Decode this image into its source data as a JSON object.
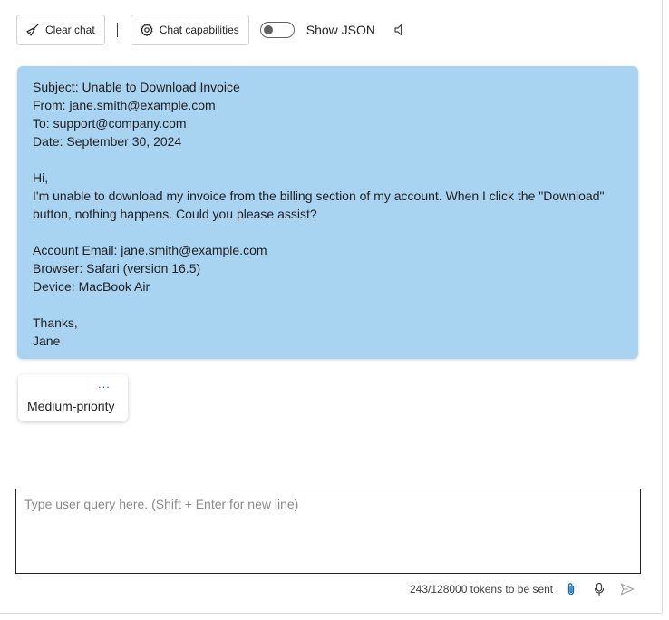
{
  "toolbar": {
    "clear_chat_label": "Clear chat",
    "chat_capabilities_label": "Chat capabilities",
    "show_json_label": "Show JSON",
    "show_json_on": false
  },
  "message": {
    "lines": [
      "Subject: Unable to Download Invoice",
      "From: jane.smith@example.com",
      "To: support@company.com",
      "Date: September 30, 2024",
      "",
      "Hi,",
      "I'm unable to download my invoice from the billing section of my account. When I click the \"Download\"",
      "button, nothing happens. Could you please assist?",
      "",
      "Account Email: jane.smith@example.com",
      "Browser: Safari (version 16.5)",
      "Device: MacBook Air",
      "",
      "Thanks,",
      "Jane"
    ]
  },
  "response": {
    "more_label": "...",
    "text": "Medium-priority"
  },
  "input": {
    "placeholder": "Type user query here. (Shift + Enter for new line)",
    "value": ""
  },
  "footer": {
    "tokens_text": "243/128000 tokens to be sent"
  },
  "colors": {
    "bubble_bg": "#a8d3f1",
    "accent": "#0f6cbd"
  },
  "icons": {
    "clear_chat": "broom-icon",
    "chat_capabilities": "gear-icon",
    "speaker": "speaker-icon",
    "attach": "paperclip-icon",
    "mic": "microphone-icon",
    "send": "send-icon"
  }
}
